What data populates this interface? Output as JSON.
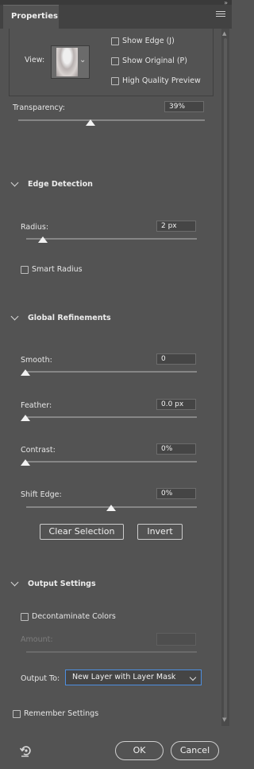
{
  "panel": {
    "tab_label": "Properties"
  },
  "view": {
    "label": "View:",
    "show_edge": "Show Edge (J)",
    "show_original": "Show Original (P)",
    "high_quality": "High Quality Preview"
  },
  "transparency": {
    "label": "Transparency:",
    "value": "39%",
    "level": 0.39
  },
  "edge_detection": {
    "heading": "Edge Detection",
    "radius_label": "Radius:",
    "radius_value": "2 px",
    "smart_radius": "Smart Radius"
  },
  "global_refinements": {
    "heading": "Global Refinements",
    "smooth_label": "Smooth:",
    "smooth_value": "0",
    "feather_label": "Feather:",
    "feather_value": "0.0 px",
    "contrast_label": "Contrast:",
    "contrast_value": "0%",
    "shift_label": "Shift Edge:",
    "shift_value": "0%",
    "clear_selection": "Clear Selection",
    "invert": "Invert"
  },
  "output": {
    "heading": "Output Settings",
    "decontaminate": "Decontaminate Colors",
    "amount_label": "Amount:",
    "output_to_label": "Output To:",
    "output_to_value": "New Layer with Layer Mask"
  },
  "footer": {
    "remember": "Remember Settings",
    "ok": "OK",
    "cancel": "Cancel"
  }
}
